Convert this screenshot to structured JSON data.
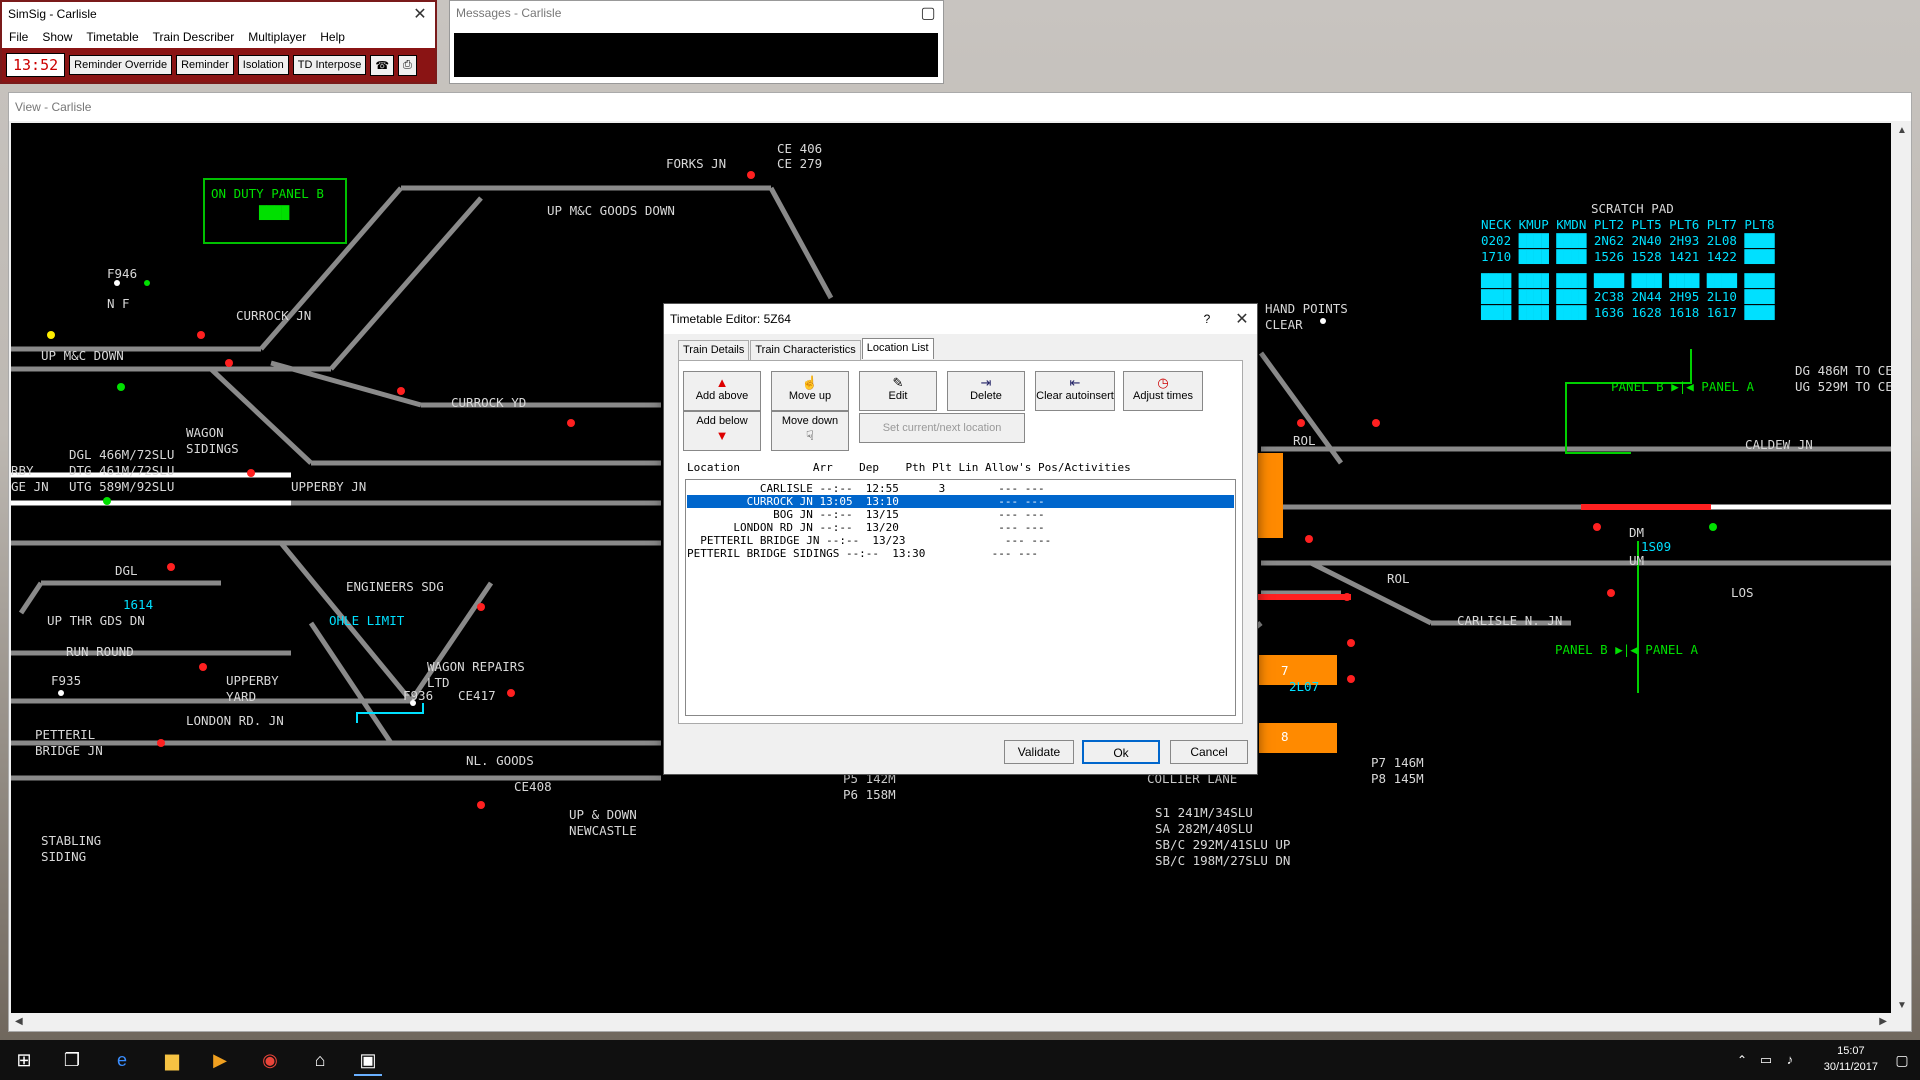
{
  "main_window": {
    "title": "SimSig - Carlisle",
    "menu": [
      "File",
      "Show",
      "Timetable",
      "Train Describer",
      "Multiplayer",
      "Help"
    ],
    "clock": "13:52",
    "toolbar_buttons": [
      "Reminder Override",
      "Reminder",
      "Isolation",
      "TD Interpose"
    ]
  },
  "messages_window": {
    "title": "Messages - Carlisle"
  },
  "view_window": {
    "title": "View - Carlisle"
  },
  "panel": {
    "labels": {
      "on_duty": "ON DUTY PANEL B",
      "forks_jn": "FORKS JN",
      "ce406": "CE 406",
      "ce279": "CE 279",
      "up_mc_goods_down": "UP M&C GOODS DOWN",
      "f946": "F946",
      "nf1": "N F",
      "currock_jn": "CURROCK JN",
      "up_mc_down": "UP M&C DOWN",
      "currock_yd": "CURROCK YD",
      "wagon_sidings": "WAGON\nSIDINGS",
      "dgl": "DGL 466M/72SLU",
      "dtg": "DTG 461M/72SLU",
      "utg": "UTG 589M/92SLU",
      "rby": "RBY",
      "ge_jn": "GE JN",
      "upperby_jn": "UPPERBY JN",
      "dgl2": "DGL",
      "engineers_sdg": "ENGINEERS SDG",
      "td_1614": "1614",
      "up_thr_gds_dn": "UP THR GDS DN",
      "ohle_limit": "OHLE LIMIT",
      "run_round": "RUN ROUND",
      "wagon_repairs": "WAGON REPAIRS\nLTD",
      "f935": "F935",
      "upperby_yard": "UPPERBY\nYARD",
      "f936": "F936",
      "ce417": "CE417",
      "london_rd_jn": "LONDON RD. JN",
      "petteril_bridge_jn": "PETTERIL\nBRIDGE JN",
      "nl_goods": "NL. GOODS",
      "ce408": "CE408",
      "up_down_newcastle": "UP & DOWN\nNEWCASTLE",
      "stabling_siding": "STABLING\nSIDING",
      "scratch_pad": "SCRATCH PAD",
      "scratch_header": "NECK KMUP KMDN PLT2 PLT5 PLT6 PLT7 PLT8",
      "scratch_row1": "0202 ████ ████ 2N62 2N40 2H93 2L08 ████",
      "scratch_row2": "1710 ████ ████ 1526 1528 1421 1422 ████",
      "scratch_row3": "████ ████ ████ ████ ████ ████ ████ ████",
      "scratch_row4": "████ ████ ████ 2C38 2N44 2H95 2L10 ████",
      "scratch_row5": "████ ████ ████ 1636 1628 1618 1617 ████",
      "hand_points": "HAND POINTS",
      "clear": "CLEAR",
      "dg": "DG 486M TO CE",
      "ug": "UG 529M TO CE",
      "panel_b_a_1": "PANEL B ▶|◀ PANEL A",
      "caldew_jn": "CALDEW JN",
      "rol1": "ROL",
      "rol2": "ROL",
      "dm": "DM",
      "um": "UM",
      "td_1s09": "1S09",
      "los": "LOS",
      "carlisle_n_jn": "CARLISLE N. JN",
      "panel_b_a_2": "PANEL B ▶|◀ PANEL A",
      "plat7": "7",
      "td_2l07": "2L07",
      "plat8": "8",
      "p5": "P5 142M",
      "p6": "P6 158M",
      "collier_lane": "COLLIER LANE",
      "p7": "P7 146M",
      "p8": "P8 145M",
      "s1": "S1 241M/34SLU",
      "sa": "SA 282M/40SLU",
      "sbc_up": "SB/C 292M/41SLU UP",
      "sbc_dn": "SB/C 198M/27SLU DN"
    }
  },
  "dialog": {
    "title": "Timetable Editor: 5Z64",
    "help": "?",
    "tabs": [
      "Train Details",
      "Train Characteristics",
      "Location List"
    ],
    "active_tab": "Location List",
    "buttons": {
      "add_above": "Add above",
      "add_below": "Add below",
      "move_up": "Move up",
      "move_down": "Move down",
      "edit": "Edit",
      "delete": "Delete",
      "clear_autoinsert": "Clear autoinsert",
      "adjust_times": "Adjust times",
      "set_current": "Set current/next location"
    },
    "list_header": "Location           Arr    Dep    Pth Plt Lin Allow's Pos/Activities",
    "rows": [
      "           CARLISLE --:--  12:55      3        --- ---",
      "         CURROCK JN 13:05  13:10               --- ---",
      "             BOG JN --:--  13/15               --- ---",
      "       LONDON RD JN --:--  13/20               --- ---",
      "  PETTERIL BRIDGE JN --:--  13/23               --- ---",
      "PETTERIL BRIDGE SIDINGS --:--  13:30          --- ---"
    ],
    "footer": {
      "validate": "Validate",
      "ok": "Ok",
      "cancel": "Cancel"
    }
  },
  "taskbar": {
    "time": "15:07",
    "date": "30/11/2017"
  }
}
